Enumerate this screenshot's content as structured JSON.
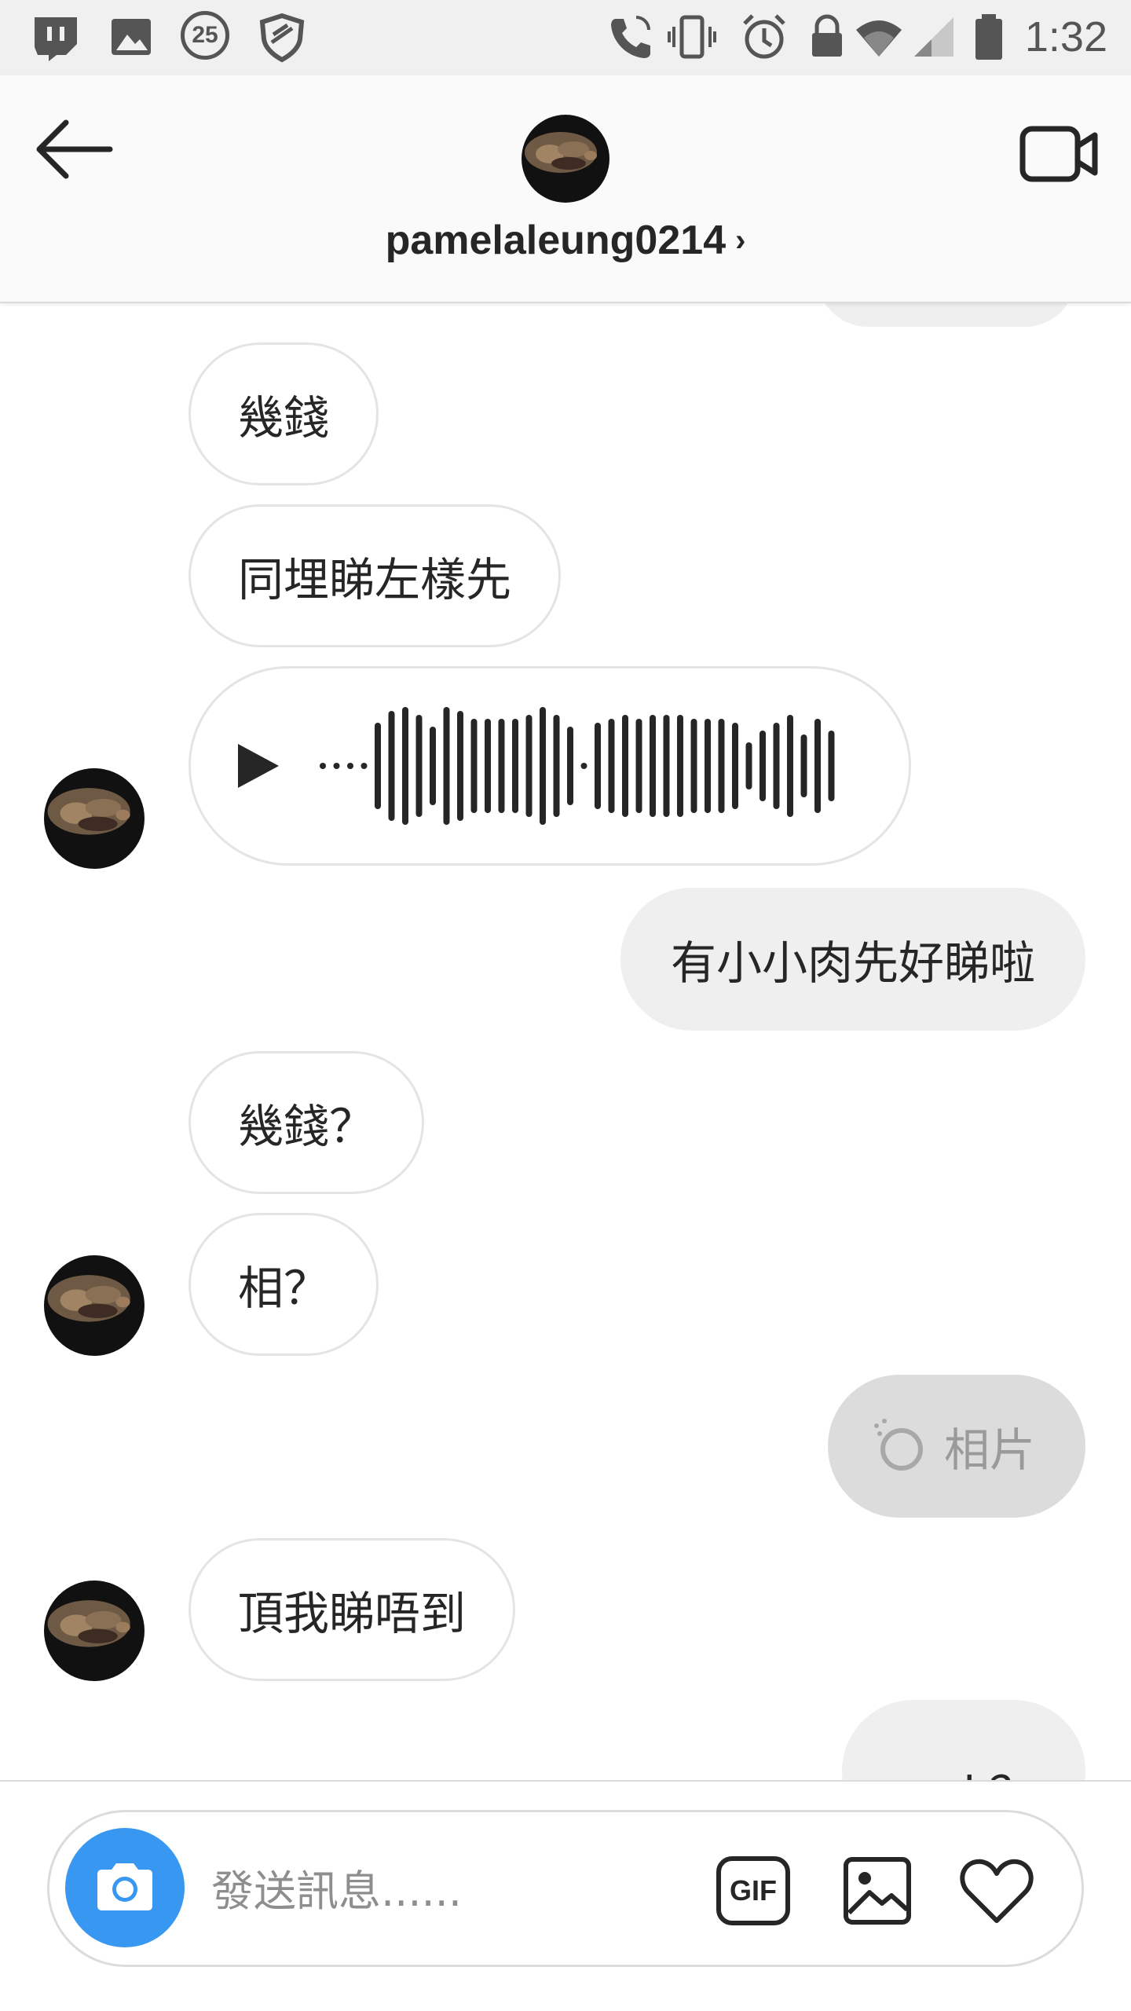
{
  "status_bar": {
    "time": "1:32",
    "notification_count": "25",
    "left_icons": [
      "twitch-icon",
      "gallery-icon",
      "badge-25-icon",
      "shield-icon"
    ],
    "right_icons": [
      "wifi-call-icon",
      "vibrate-icon",
      "alarm-icon",
      "lock-icon",
      "wifi-icon",
      "signal-icon",
      "battery-icon"
    ]
  },
  "header": {
    "username": "pamelaleung0214",
    "chevron": "›"
  },
  "messages": [
    {
      "side": "in",
      "text": "幾錢"
    },
    {
      "side": "in",
      "text": "同埋睇左樣先"
    },
    {
      "side": "in",
      "type": "voice"
    },
    {
      "side": "out",
      "text": "有小小肉先好睇啦"
    },
    {
      "side": "in",
      "text": "幾錢？"
    },
    {
      "side": "in",
      "text": "相？"
    },
    {
      "side": "out",
      "type": "photo",
      "text": "相片"
    },
    {
      "side": "in",
      "text": "頂我睇唔到"
    },
    {
      "side": "out",
      "text": "u ok？"
    }
  ],
  "composer": {
    "placeholder": "發送訊息......",
    "value": "",
    "gif_label": "GIF"
  },
  "colors": {
    "accent_blue": "#3897f0",
    "incoming_bubble_border": "#e4e4e4",
    "outgoing_bubble_bg": "#efefef",
    "status_bar_bg": "#f0f0f0"
  }
}
